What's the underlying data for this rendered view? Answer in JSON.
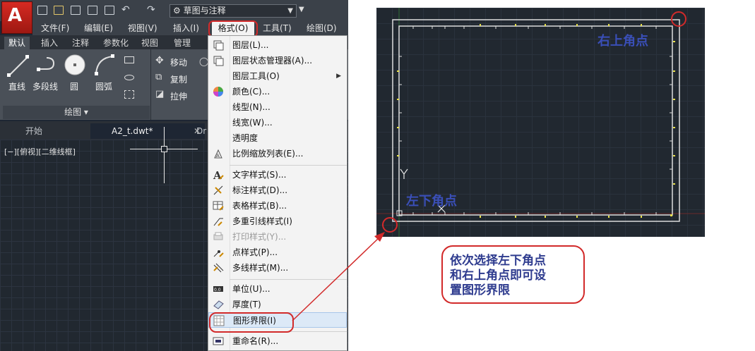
{
  "app": {
    "logo_letter": "A",
    "workspace": "草图与注释",
    "menu": [
      "文件(F)",
      "编辑(E)",
      "视图(V)",
      "插入(I)",
      "格式(O)",
      "工具(T)",
      "绘图(D)"
    ],
    "ribbon_tabs": [
      "默认",
      "插入",
      "注释",
      "参数化",
      "视图",
      "管理"
    ],
    "draw_tools": [
      "直线",
      "多段线",
      "圆",
      "圆弧"
    ],
    "modify_tools": [
      "移动",
      "复制",
      "拉伸"
    ],
    "draw_panel_title": "绘图 ▾",
    "file_tabs": [
      "开始",
      "A2_t.dwt*",
      "Dr"
    ],
    "view_label": "[−][俯视][二维线框]"
  },
  "format_menu": {
    "items": [
      {
        "label": "图层(L)...",
        "icon": "layer-icon"
      },
      {
        "label": "图层状态管理器(A)...",
        "icon": "layer-state-icon"
      },
      {
        "label": "图层工具(O)",
        "icon": "",
        "submenu": true
      },
      {
        "label": "颜色(C)...",
        "icon": "color-wheel-icon"
      },
      {
        "label": "线型(N)...",
        "icon": ""
      },
      {
        "label": "线宽(W)...",
        "icon": ""
      },
      {
        "label": "透明度",
        "icon": ""
      },
      {
        "label": "比例缩放列表(E)...",
        "icon": "scale-list-icon"
      },
      {
        "label": "文字样式(S)...",
        "icon": "text-style-icon"
      },
      {
        "label": "标注样式(D)...",
        "icon": "dim-style-icon"
      },
      {
        "label": "表格样式(B)...",
        "icon": "table-style-icon"
      },
      {
        "label": "多重引线样式(I)",
        "icon": "mleader-style-icon"
      },
      {
        "label": "打印样式(Y)...",
        "icon": "plot-style-icon",
        "disabled": true
      },
      {
        "label": "点样式(P)...",
        "icon": "point-style-icon"
      },
      {
        "label": "多线样式(M)...",
        "icon": "mline-style-icon"
      },
      {
        "label": "单位(U)...",
        "icon": "units-icon"
      },
      {
        "label": "厚度(T)",
        "icon": "thickness-icon"
      },
      {
        "label": "图形界限(I)",
        "icon": "limits-icon",
        "highlighted": true
      },
      {
        "label": "重命名(R)...",
        "icon": "rename-icon"
      }
    ]
  },
  "annotations": {
    "upper_right": "右上角点",
    "lower_left": "左下角点",
    "callout_lines": [
      "依次选择左下角点",
      "和右上角点即可设",
      "置图形界限"
    ]
  },
  "colors": {
    "highlight_circle": "#d22a2a",
    "annotation_text": "#3a4fb8",
    "canvas_bg": "#212830"
  }
}
